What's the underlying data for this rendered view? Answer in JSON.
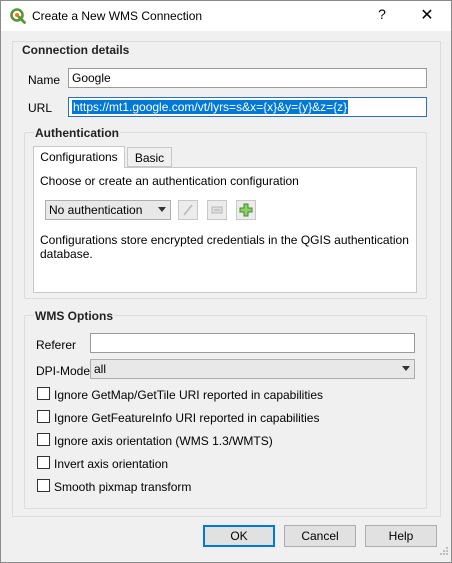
{
  "window": {
    "title": "Create a New WMS Connection",
    "help_glyph": "?",
    "close_glyph": "✕"
  },
  "connection": {
    "group_title": "Connection details",
    "name_label": "Name",
    "name_value": "Google",
    "url_label": "URL",
    "url_value": "https://mt1.google.com/vt/lyrs=s&x={x}&y={y}&z={z}"
  },
  "authentication": {
    "group_title": "Authentication",
    "tabs": [
      {
        "label": "Configurations",
        "active": true
      },
      {
        "label": "Basic",
        "active": false
      }
    ],
    "prompt": "Choose or create an authentication configuration",
    "selected_config": "No authentication",
    "info_line1": "Configurations store encrypted credentials in the QGIS authentication",
    "info_line2": "database."
  },
  "wms_options": {
    "group_title": "WMS Options",
    "referer_label": "Referer",
    "referer_value": "",
    "dpi_label": "DPI-Mode",
    "dpi_value": "all",
    "checkboxes": [
      {
        "label": "Ignore GetMap/GetTile URI reported in capabilities",
        "checked": false
      },
      {
        "label": "Ignore GetFeatureInfo URI reported in capabilities",
        "checked": false
      },
      {
        "label": "Ignore axis orientation (WMS 1.3/WMTS)",
        "checked": false
      },
      {
        "label": "Invert axis orientation",
        "checked": false
      },
      {
        "label": "Smooth pixmap transform",
        "checked": false
      }
    ]
  },
  "buttons": {
    "ok": "OK",
    "cancel": "Cancel",
    "help": "Help"
  },
  "colors": {
    "accent": "#0078d7",
    "qgis_green": "#589632",
    "qgis_yellow": "#ee7913"
  }
}
